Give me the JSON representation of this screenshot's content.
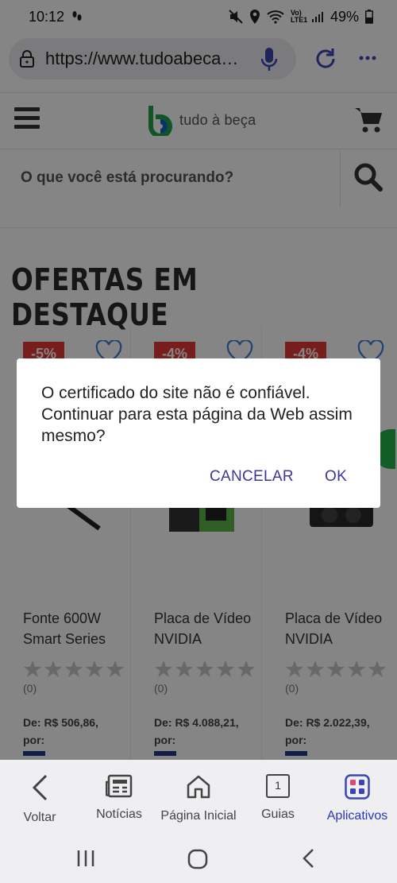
{
  "status_bar": {
    "time": "10:12",
    "battery": "49%",
    "volte_label": "Vo) LTE1"
  },
  "browser": {
    "url": "https://www.tudoabeca.com.br"
  },
  "site": {
    "logo_text": "tudo à beça",
    "search_placeholder": "O que você está procurando?",
    "section_title": "OFERTAS EM DESTAQUE",
    "brand_colors": {
      "green": "#1fa34a",
      "blue": "#1565c0",
      "sale": "#e53935"
    }
  },
  "products": [
    {
      "discount": "-5%",
      "name": "Fonte 600W Smart Series",
      "rating": "(0)",
      "price": "De: R$ 506,86, por:"
    },
    {
      "discount": "-4%",
      "name": "Placa de Vídeo NVIDIA",
      "rating": "(0)",
      "price": "De: R$ 4.088,21, por:"
    },
    {
      "discount": "-4%",
      "name": "Placa de Vídeo NVIDIA",
      "rating": "(0)",
      "price": "De: R$ 2.022,39, por:"
    }
  ],
  "dialog": {
    "message": "O certificado do site não é confiável. Continuar para esta página da Web assim mesmo?",
    "cancel_label": "CANCELAR",
    "ok_label": "OK"
  },
  "bottom_nav": [
    {
      "label": "Voltar",
      "icon": "back-arrow-icon"
    },
    {
      "label": "Notícias",
      "icon": "news-icon"
    },
    {
      "label": "Página Inicial",
      "icon": "home-icon"
    },
    {
      "label": "Guias",
      "icon": "tabs-icon",
      "count": "1"
    },
    {
      "label": "Aplicativos",
      "icon": "apps-icon",
      "active": true
    }
  ]
}
